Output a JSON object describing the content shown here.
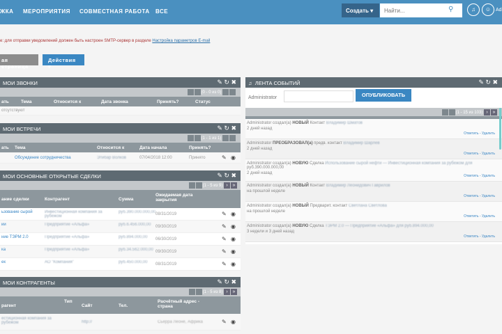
{
  "nav": {
    "items": [
      "ЖКА",
      "МЕРОПРИЯТИЯ",
      "СОВМЕСТНАЯ РАБОТА",
      "ВСЕ"
    ],
    "create": "Создать",
    "search_placeholder": "Найти...",
    "user": "Ad"
  },
  "warning": {
    "text": "е: для отправки уведомлений должен быть настроен SMTP-сервер в разделе ",
    "link": "Настройка параметров E-mail"
  },
  "buttons": {
    "home": "ая страница",
    "actions": "Действия"
  },
  "calls": {
    "title": "МОИ ЗВОНКИ",
    "pager": "(0 - 0 из 0)",
    "cols": [
      "ать",
      "Тема",
      "Относится к",
      "Дата звонка",
      "Принять?",
      "Статус"
    ],
    "empty": "отсутствуют"
  },
  "meetings": {
    "title": "МОИ ВСТРЕЧИ",
    "pager": "(1 - 1 из 1)",
    "cols": [
      "ать",
      "Тема",
      "Относится к",
      "Дата начала",
      "Принять?"
    ],
    "row": [
      "Обсуждение сотрудничества",
      "Этибар Волков",
      "07/04/2018 12:00",
      "Принято"
    ]
  },
  "deals": {
    "title": "МОИ ОСНОВНЫЕ ОТКРЫТЫЕ СДЕЛКИ",
    "pager": "(1 - 5 из 9)",
    "cols": [
      "ание сделки",
      "Контрагент",
      "Сумма",
      "Ожидаемая дата закрытия"
    ],
    "rows": [
      [
        "ьзование сырой",
        "Инвестиционная компания за рубежом",
        "руб.390.000.000,00",
        "08/31/2019"
      ],
      [
        "ии",
        "Предприятие «Альфа»",
        "руб.6.456.000,00",
        "09/30/2019"
      ],
      [
        "ние ТЭРМ 2.0",
        "Предприятие «Альфа»",
        "руб.894.000,00",
        "06/30/2019"
      ],
      [
        "ка",
        "Предприятие «Альфа»",
        "руб.34.562.000,00",
        "09/30/2019"
      ],
      [
        "ек",
        "АО \"Компания\"",
        "руб.450.000,00",
        "08/31/2019"
      ]
    ]
  },
  "accounts": {
    "title": "МОИ КОНТРАГЕНТЫ",
    "pager": "(1 - 5 из 8)",
    "cols": [
      "рагент",
      "Тип",
      "Сайт",
      "Тел.",
      "Расчётный адрес - страна"
    ],
    "row": [
      "естиционная компания за рубежом",
      "http://",
      "Сьерра Леоне, Африка"
    ]
  },
  "feed": {
    "title": "ЛЕНТА СОБЫТИЙ",
    "user": "Administrator",
    "post": "ОПУБЛИКОВАТЬ",
    "pager": "(1 - 15 из 103)",
    "actions": "Ответить - Удалить",
    "items": [
      {
        "pre": "Administrator создал(а) ",
        "verb": "НОВЫЙ",
        "obj": " Контакт ",
        "link": "Владимир Шматов",
        "extra": "",
        "time": "2 дней назад"
      },
      {
        "pre": "Administrator ",
        "verb": "ПРЕОБРАЗОВАЛ(а)",
        "obj": " предв. контакт ",
        "link": "Владимир Шарлев",
        "extra": "",
        "time": "2 дней назад"
      },
      {
        "pre": "Administrator создал(а) ",
        "verb": "НОВУЮ",
        "obj": " Сделка ",
        "link": "Использование сырой нефти — Инвестиционная компания за рубежом для",
        "extra": "руб.390.000.000,00",
        "time": "2 дней назад"
      },
      {
        "pre": "Administrator создал(а) ",
        "verb": "НОВЫЙ",
        "obj": " Контакт ",
        "link": "Владимир Леонидович Гаврилов",
        "extra": "",
        "time": "на прошлой неделе"
      },
      {
        "pre": "Administrator создал(а) ",
        "verb": "НОВЫЙ",
        "obj": " Предварит. контакт ",
        "link": "Светлана Светлова",
        "extra": "",
        "time": "на прошлой неделе"
      },
      {
        "pre": "Administrator создал(а) ",
        "verb": "НОВУЮ",
        "obj": " Сделка ",
        "link": "ТЭРМ 2.0 — Предприятие «Альфа» для руб.894.000,00",
        "extra": "",
        "time": "3 недели и 3 дней назад"
      }
    ]
  }
}
